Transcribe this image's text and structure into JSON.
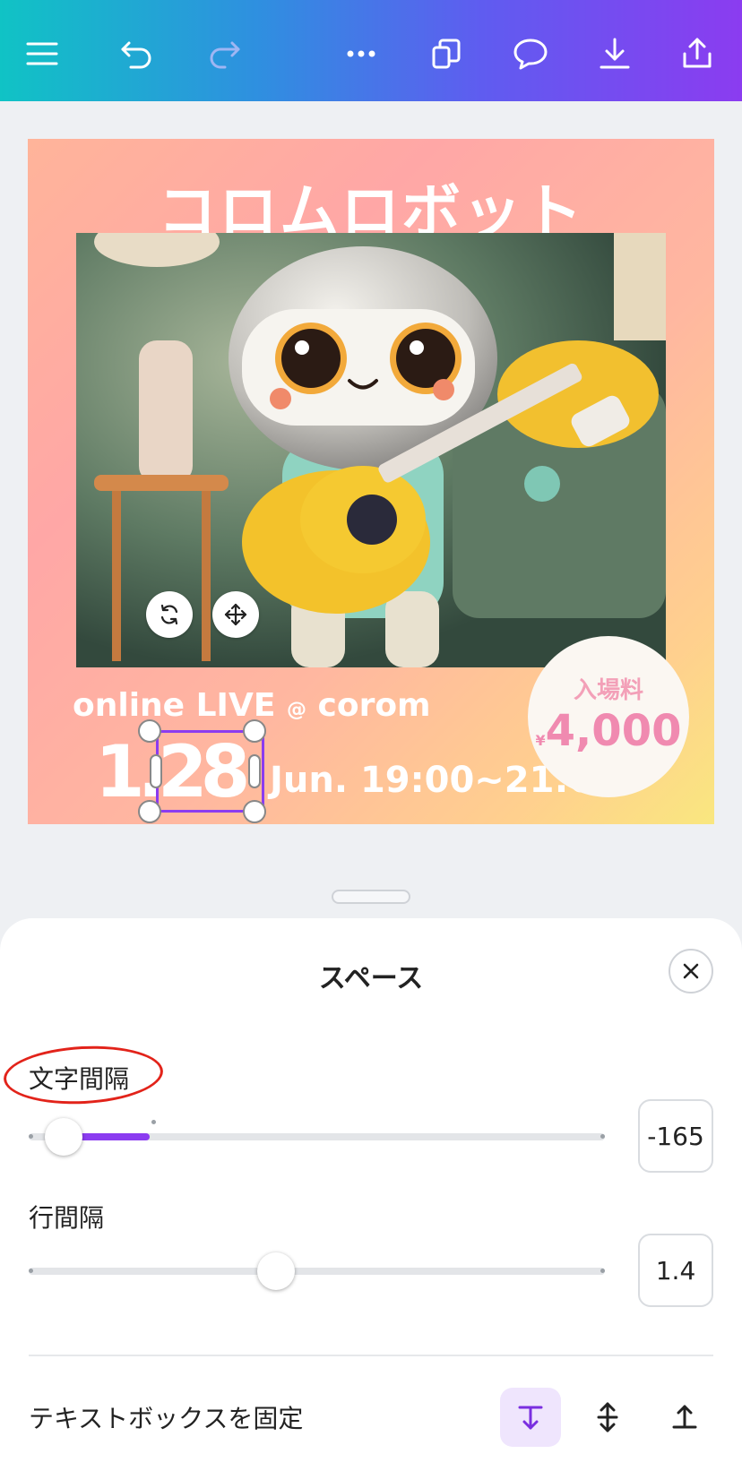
{
  "toolbar": {
    "icons": [
      "menu-icon",
      "undo-icon",
      "redo-icon",
      "more-icon",
      "duplicate-icon",
      "comment-icon",
      "download-icon",
      "share-icon"
    ],
    "gradient": [
      "#10c3c5",
      "#8b3cf0"
    ]
  },
  "design": {
    "title": "コロムロボット",
    "online_text": "online LIVE",
    "at_symbol": "@",
    "online_suffix": "corom",
    "date_big": "1.28",
    "date_small": "Jun. 19:00~21:00",
    "fee_label": "入場料",
    "fee_yen": "¥",
    "fee_amount": "4,000"
  },
  "sheet": {
    "title": "スペース",
    "letter_spacing_label": "文字間隔",
    "letter_spacing_value": "-165",
    "letter_spacing_fraction": 0.06,
    "line_spacing_label": "行間隔",
    "line_spacing_value": "1.4",
    "line_spacing_fraction": 0.43,
    "fix_textbox_label": "テキストボックスを固定",
    "accent_color": "#8b3cf0"
  }
}
